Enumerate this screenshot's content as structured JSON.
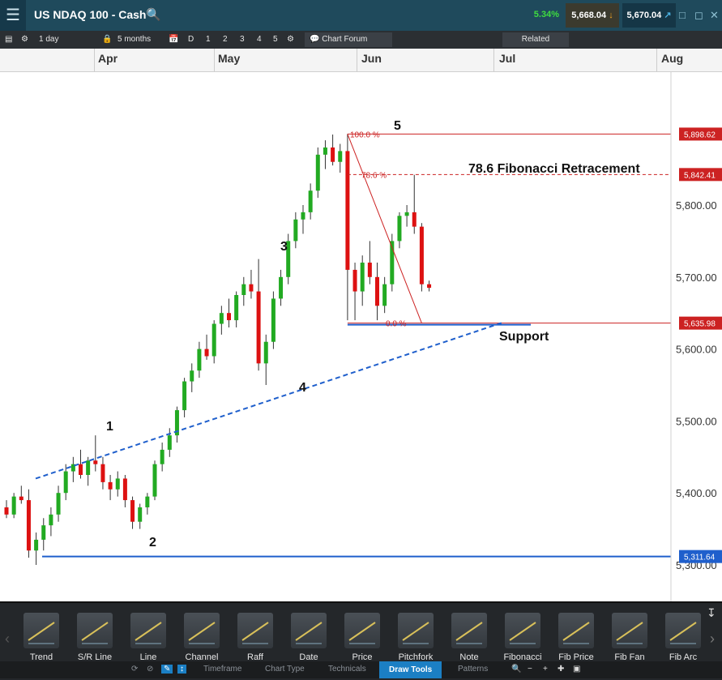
{
  "header": {
    "title": "US NDAQ 100 - Cash",
    "change_pct": "5.34%",
    "sell_price": "5,668.04",
    "buy_price": "5,670.04"
  },
  "toolbar": {
    "interval": "1 day",
    "range": "5 months",
    "periods": [
      "D",
      "1",
      "2",
      "3",
      "4",
      "5"
    ],
    "chart_forum": "Chart Forum",
    "related": "Related"
  },
  "months": [
    "Apr",
    "May",
    "Jun",
    "Jul",
    "Aug"
  ],
  "price_axis": [
    "5,800.00",
    "5,700.00",
    "5,600.00",
    "5,500.00",
    "5,400.00",
    "5,300.00"
  ],
  "price_tags": [
    "5,898.62",
    "5,842.41",
    "5,635.98",
    "5,311.64"
  ],
  "annotations": {
    "wave1": "1",
    "wave2": "2",
    "wave3": "3",
    "wave4": "4",
    "wave5": "5",
    "fib_title": "78.6 Fibonacci Retracement",
    "support": "Support",
    "fib100": "100.0 %",
    "fib786": "78.6 %",
    "fib0": "0.0 %"
  },
  "colors": {
    "up": "#22aa22",
    "down": "#dd1111",
    "fib": "#cc2222",
    "trend": "#1f5fcc"
  },
  "tools": [
    "Trend",
    "S/R Line",
    "Line",
    "Channel",
    "Raff",
    "Date",
    "Price",
    "Pitchfork",
    "Note",
    "Fibonacci",
    "Fib Price",
    "Fib Fan",
    "Fib Arc"
  ],
  "tabs": [
    "Timeframe",
    "Chart Type",
    "Technicals",
    "Draw Tools",
    "Patterns"
  ],
  "chart_data": {
    "type": "candlestick",
    "x_labels": [
      "Apr",
      "May",
      "Jun",
      "Jul",
      "Aug"
    ],
    "ylim": [
      5280,
      5960
    ],
    "candles": [
      [
        5380,
        5390,
        5365,
        5370
      ],
      [
        5370,
        5400,
        5365,
        5395
      ],
      [
        5395,
        5410,
        5385,
        5390
      ],
      [
        5390,
        5405,
        5310,
        5320
      ],
      [
        5320,
        5345,
        5300,
        5335
      ],
      [
        5335,
        5365,
        5320,
        5355
      ],
      [
        5355,
        5380,
        5340,
        5370
      ],
      [
        5370,
        5410,
        5360,
        5400
      ],
      [
        5400,
        5440,
        5390,
        5430
      ],
      [
        5430,
        5450,
        5415,
        5440
      ],
      [
        5440,
        5460,
        5420,
        5425
      ],
      [
        5425,
        5450,
        5410,
        5445
      ],
      [
        5445,
        5480,
        5430,
        5440
      ],
      [
        5440,
        5450,
        5405,
        5415
      ],
      [
        5415,
        5425,
        5390,
        5405
      ],
      [
        5405,
        5430,
        5395,
        5420
      ],
      [
        5420,
        5425,
        5380,
        5390
      ],
      [
        5390,
        5395,
        5350,
        5360
      ],
      [
        5360,
        5385,
        5350,
        5380
      ],
      [
        5380,
        5400,
        5370,
        5395
      ],
      [
        5395,
        5445,
        5390,
        5440
      ],
      [
        5440,
        5470,
        5430,
        5460
      ],
      [
        5460,
        5490,
        5450,
        5480
      ],
      [
        5480,
        5520,
        5470,
        5515
      ],
      [
        5515,
        5560,
        5505,
        5555
      ],
      [
        5555,
        5580,
        5540,
        5570
      ],
      [
        5570,
        5610,
        5560,
        5600
      ],
      [
        5600,
        5620,
        5585,
        5590
      ],
      [
        5590,
        5640,
        5580,
        5635
      ],
      [
        5635,
        5660,
        5620,
        5650
      ],
      [
        5650,
        5670,
        5630,
        5640
      ],
      [
        5640,
        5680,
        5630,
        5675
      ],
      [
        5675,
        5700,
        5660,
        5690
      ],
      [
        5690,
        5710,
        5670,
        5680
      ],
      [
        5680,
        5725,
        5570,
        5580
      ],
      [
        5580,
        5620,
        5550,
        5610
      ],
      [
        5610,
        5680,
        5600,
        5670
      ],
      [
        5670,
        5710,
        5660,
        5700
      ],
      [
        5700,
        5760,
        5690,
        5750
      ],
      [
        5750,
        5790,
        5740,
        5780
      ],
      [
        5780,
        5800,
        5760,
        5790
      ],
      [
        5790,
        5830,
        5780,
        5820
      ],
      [
        5820,
        5880,
        5810,
        5870
      ],
      [
        5870,
        5890,
        5850,
        5880
      ],
      [
        5880,
        5898,
        5855,
        5860
      ],
      [
        5860,
        5885,
        5845,
        5875
      ],
      [
        5875,
        5899,
        5640,
        5710
      ],
      [
        5710,
        5720,
        5640,
        5680
      ],
      [
        5680,
        5730,
        5660,
        5720
      ],
      [
        5720,
        5750,
        5690,
        5700
      ],
      [
        5700,
        5720,
        5640,
        5660
      ],
      [
        5660,
        5700,
        5650,
        5690
      ],
      [
        5690,
        5760,
        5680,
        5750
      ],
      [
        5750,
        5790,
        5740,
        5785
      ],
      [
        5785,
        5800,
        5770,
        5790
      ],
      [
        5790,
        5842,
        5760,
        5770
      ],
      [
        5770,
        5775,
        5680,
        5690
      ],
      [
        5690,
        5695,
        5680,
        5685
      ]
    ],
    "fibonacci": [
      {
        "level": "100.0 %",
        "price": 5898.62
      },
      {
        "level": "78.6 %",
        "price": 5842.41
      },
      {
        "level": "0.0 %",
        "price": 5635.98
      }
    ],
    "support_price": 5311.64,
    "trendline": [
      [
        0,
        5420
      ],
      [
        36,
        5550
      ],
      [
        67,
        5637
      ]
    ],
    "waves": [
      {
        "label": "1",
        "index": 12
      },
      {
        "label": "2",
        "index": 18
      },
      {
        "label": "3",
        "index": 34
      },
      {
        "label": "4",
        "index": 35
      },
      {
        "label": "5",
        "index": 46
      }
    ]
  }
}
